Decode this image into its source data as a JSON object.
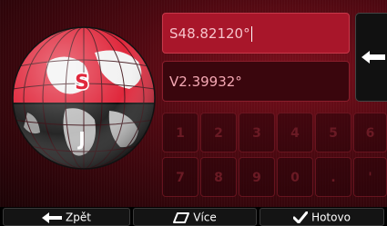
{
  "globe": {
    "north_label": "S",
    "south_label": "J",
    "icon": "globe-icon",
    "north_color": "#e0283c",
    "south_color": "#2a2a2a"
  },
  "latitude": {
    "value": "S48.82120°"
  },
  "longitude": {
    "value": "V2.39932°"
  },
  "backspace": {
    "icon": "backspace-arrow-icon"
  },
  "keypad": {
    "row1": [
      "1",
      "2",
      "3",
      "4",
      "5",
      "6"
    ],
    "row2": [
      "7",
      "8",
      "9",
      "0",
      ".",
      "'"
    ]
  },
  "footer": {
    "back_label": "Zpět",
    "more_label": "Více",
    "done_label": "Hotovo",
    "back_icon": "arrow-left-icon",
    "more_icon": "parallelogram-icon",
    "done_icon": "checkmark-icon"
  },
  "colors": {
    "accent": "#a8162a",
    "background": "#4a0810"
  }
}
